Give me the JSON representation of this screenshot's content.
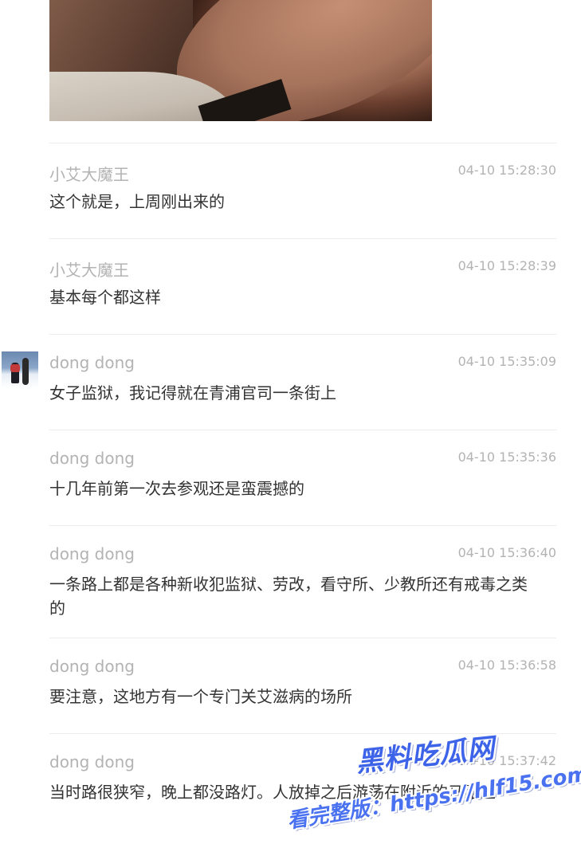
{
  "photo": {
    "alt": "posted photo"
  },
  "comments": [
    {
      "username": "小艾大魔王",
      "timestamp": "04-10 15:28:30",
      "message": "这个就是，上周刚出来的"
    },
    {
      "username": "小艾大魔王",
      "timestamp": "04-10 15:28:39",
      "message": "基本每个都这样"
    },
    {
      "username": "dong dong",
      "timestamp": "04-10 15:35:09",
      "message": "女子监狱，我记得就在青浦官司一条街上"
    },
    {
      "username": "dong dong",
      "timestamp": "04-10 15:35:36",
      "message": "十几年前第一次去参观还是蛮震撼的"
    },
    {
      "username": "dong dong",
      "timestamp": "04-10 15:36:40",
      "message": "一条路上都是各种新收犯监狱、劳改，看守所、少教所还有戒毒之类的"
    },
    {
      "username": "dong dong",
      "timestamp": "04-10 15:36:58",
      "message": "要注意，这地方有一个专门关艾滋病的场所"
    },
    {
      "username": "dong dong",
      "timestamp": "04-10 15:37:42",
      "message": "当时路很狭窄，晚上都没路灯。人放掉之后游荡在附近的马路上"
    }
  ],
  "watermark": {
    "title": "黑料吃瓜网",
    "url": "看完整版：https://hlf15.com"
  },
  "colors": {
    "username": "#b3b3b3",
    "timestamp": "#b3b3b3",
    "message": "#333333",
    "divider": "#ececec",
    "watermark": "#3d63e8"
  }
}
